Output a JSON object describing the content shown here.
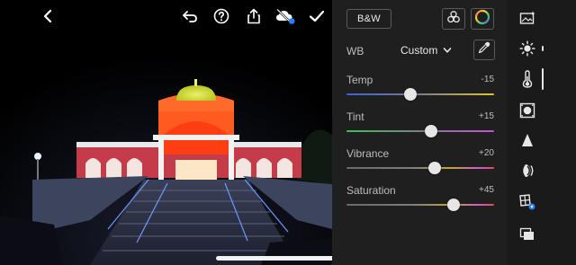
{
  "panel": {
    "bw_label": "B&W",
    "wb": {
      "label": "WB",
      "value": "Custom"
    },
    "sliders": [
      {
        "name": "Temp",
        "value": "-15",
        "position": 0.43
      },
      {
        "name": "Tint",
        "value": "+15",
        "position": 0.575
      },
      {
        "name": "Vibrance",
        "value": "+20",
        "position": 0.6
      },
      {
        "name": "Saturation",
        "value": "+45",
        "position": 0.725
      }
    ]
  },
  "toolbar": {
    "icons": [
      "back-icon",
      "undo-icon",
      "help-icon",
      "share-icon",
      "cloud-sync-icon",
      "checkmark-icon"
    ]
  },
  "rail": {
    "icons": [
      "auto-enhance-icon",
      "light-icon",
      "color-icon",
      "effects-icon",
      "detail-icon",
      "optics-icon",
      "geometry-icon",
      "versions-icon"
    ],
    "active": "color-icon"
  },
  "colors": {
    "panel_bg": "#1f1f1f",
    "rail_bg": "#1a1a1a",
    "sync_badge": "#2d7ff9"
  }
}
